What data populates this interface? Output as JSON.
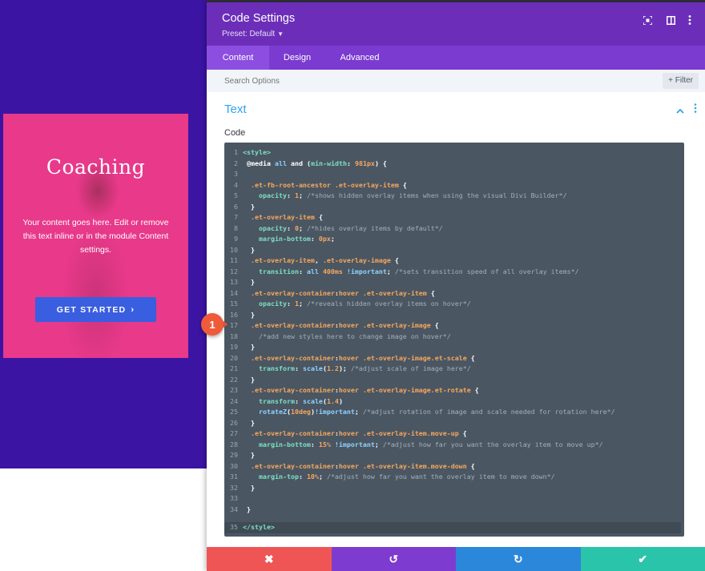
{
  "preview": {
    "card": {
      "title": "Coaching",
      "text": "Your content goes here. Edit or remove this text inline or in the module Content settings.",
      "button_label": "GET STARTED",
      "button_chevron": "›"
    }
  },
  "panel": {
    "title": "Code Settings",
    "preset": "Preset: Default",
    "header_icons": [
      "expand-icon",
      "sidebar-layout-icon",
      "more-icon"
    ],
    "tabs": [
      {
        "label": "Content",
        "active": true
      },
      {
        "label": "Design",
        "active": false
      },
      {
        "label": "Advanced",
        "active": false
      }
    ],
    "search_placeholder": "Search Options",
    "filter_label": "+ Filter",
    "section_title": "Text",
    "code_label": "Code"
  },
  "code": {
    "line_numbers": [
      "1",
      "2",
      "3",
      "4",
      "5",
      "6",
      "7",
      "8",
      "9",
      "10",
      "11",
      "12",
      "13",
      "14",
      "15",
      "16",
      "17",
      "18",
      "19",
      "20",
      "21",
      "22",
      "23",
      "24",
      "25",
      "26",
      "27",
      "28",
      "29",
      "30",
      "31",
      "32",
      "33",
      "34",
      "35"
    ]
  },
  "footer": {
    "buttons": [
      {
        "action": "discard",
        "icon": "close-icon",
        "glyph": "✖",
        "color": "#ef5555"
      },
      {
        "action": "undo",
        "icon": "undo-icon",
        "glyph": "↺",
        "color": "#7e3bd0"
      },
      {
        "action": "redo",
        "icon": "redo-icon",
        "glyph": "↻",
        "color": "#2b87da"
      },
      {
        "action": "save",
        "icon": "check-icon",
        "glyph": "✔",
        "color": "#29c4a9"
      }
    ]
  },
  "marker": {
    "label": "1"
  },
  "colors": {
    "preview_bg": "#3b14a3",
    "card_bg": "#e8398a",
    "card_button": "#3a5ee0",
    "panel_header": "#6c2eb9",
    "tabs_bg": "#7b3ad0",
    "accent_blue": "#2ea3f2",
    "code_bg": "#4a5662",
    "marker": "#ef5b3a"
  }
}
